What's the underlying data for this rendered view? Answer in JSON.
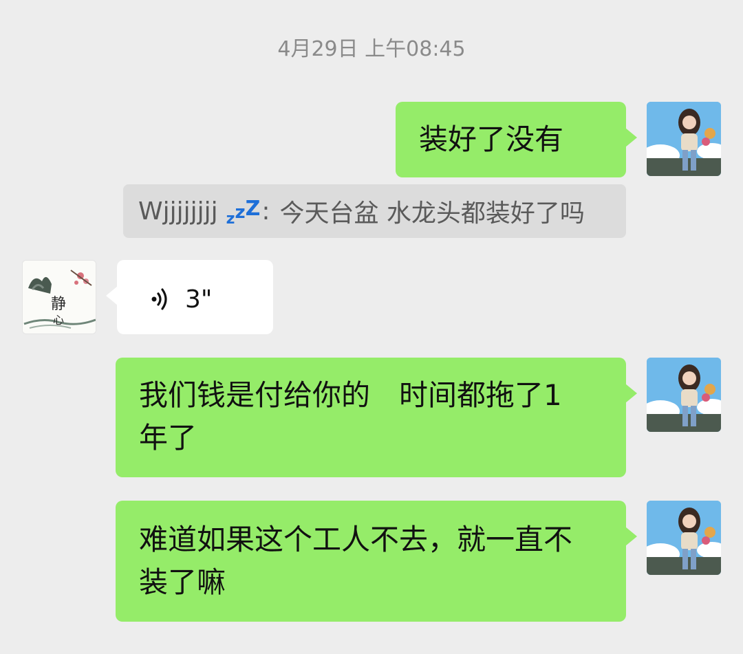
{
  "timestamp": "4月29日 上午08:45",
  "messages": [
    {
      "side": "sent",
      "text": "装好了没有"
    },
    {
      "side": "quote",
      "sender": "Wjjjjjjjj",
      "sender_badge": "zzZ",
      "separator": ":",
      "text": "今天台盆 水龙头都装好了吗"
    },
    {
      "side": "received",
      "type": "voice",
      "duration": "3\""
    },
    {
      "side": "sent",
      "line1": "我们钱是付给你的　时间都拖了1",
      "line2": "年了"
    },
    {
      "side": "sent",
      "line1": "难道如果这个工人不去，就一直不",
      "line2": "装了嘛"
    }
  ],
  "avatars": {
    "self": "avatar-girl-sitting-sky",
    "contact": "avatar-ink-painting-jingxin",
    "contact_text": "静心"
  },
  "colors": {
    "background": "#ededed",
    "sent_bubble": "#95ec69",
    "received_bubble": "#ffffff",
    "quote_bg": "#dcdcdc",
    "timestamp": "#8a8a8a",
    "badge": "#1e6fd8"
  }
}
